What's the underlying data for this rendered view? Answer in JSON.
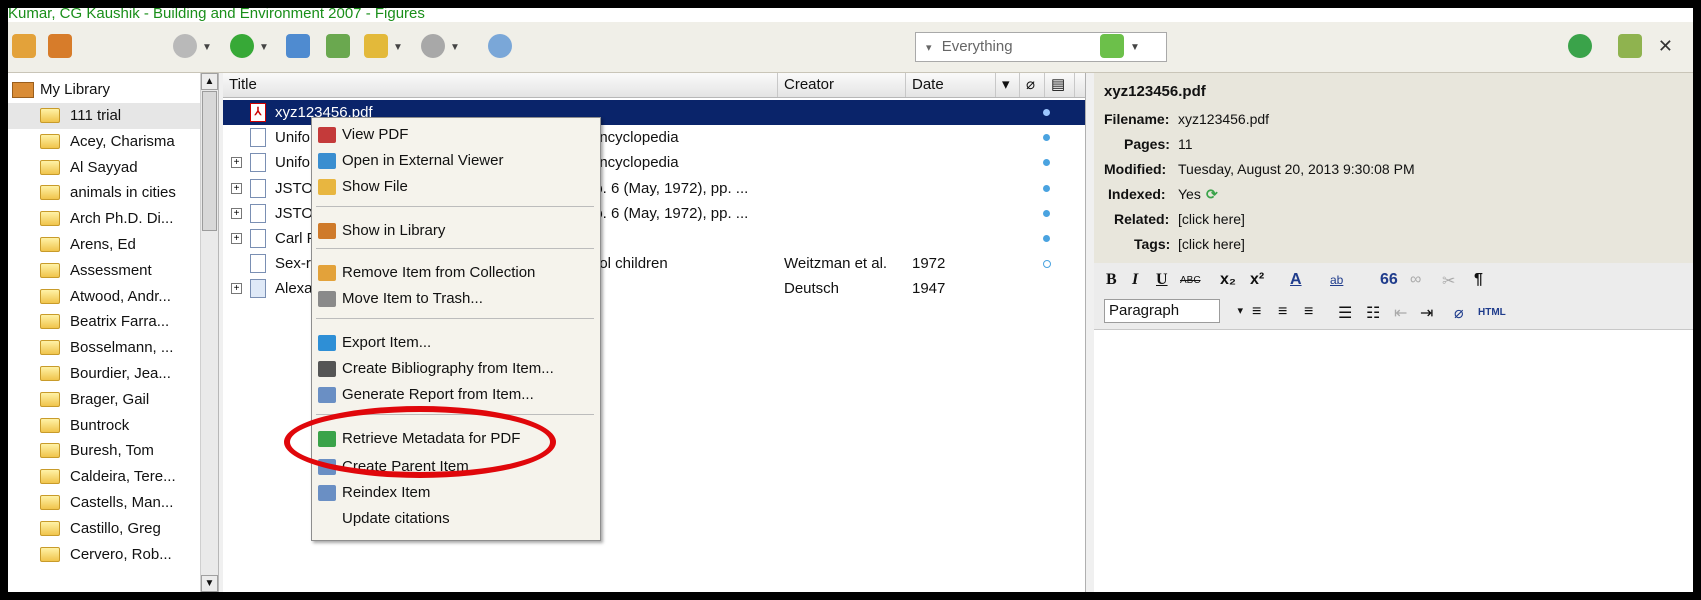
{
  "window": {
    "title": "Kumar, CG Kaushik - Building and Environment 2007 - Figures"
  },
  "toolbar": {
    "search_scope": "Everything",
    "search_dropdown_glyph": "▾"
  },
  "library": {
    "root": "My Library",
    "collections": [
      "111 trial",
      "Acey, Charisma",
      "Al Sayyad",
      "animals in cities",
      "Arch Ph.D. Di...",
      "Arens, Ed",
      "Assessment",
      "Atwood, Andr...",
      "Beatrix Farra...",
      "Bosselmann, ...",
      "Bourdier, Jea...",
      "Brager, Gail",
      "Buntrock",
      "Buresh, Tom",
      "Caldeira, Tere...",
      "Castells, Man...",
      "Castillo, Greg",
      "Cervero, Rob..."
    ]
  },
  "items": {
    "columns": {
      "title": "Title",
      "creator": "Creator",
      "date": "Date"
    },
    "rows": [
      {
        "title": "xyz123456.pdf",
        "creator": "",
        "date": "",
        "expander": "",
        "kind": "pdf",
        "selected": true
      },
      {
        "title": "Unifo",
        "title_tail": "encyclopedia",
        "creator": "",
        "date": "",
        "expander": "",
        "kind": "doc"
      },
      {
        "title": "Unifo",
        "title_tail": "encyclopedia",
        "creator": "",
        "date": "",
        "expander": "+",
        "kind": "doc"
      },
      {
        "title": "JSTO",
        "title_tail": "lo. 6 (May, 1972), pp. ...",
        "creator": "",
        "date": "",
        "expander": "+",
        "kind": "doc"
      },
      {
        "title": "JSTO",
        "title_tail": "lo. 6 (May, 1972), pp. ...",
        "creator": "",
        "date": "",
        "expander": "+",
        "kind": "doc"
      },
      {
        "title": "Carl F",
        "title_tail": "",
        "creator": "",
        "date": "",
        "expander": "+",
        "kind": "doc"
      },
      {
        "title": "Sex-r",
        "title_tail": "ool children",
        "creator": "Weitzman et al.",
        "date": "1972",
        "expander": "",
        "kind": "note"
      },
      {
        "title": "Alexa",
        "title_tail": "",
        "creator": "Deutsch",
        "date": "1947",
        "expander": "+",
        "kind": "book"
      }
    ]
  },
  "context_menu": {
    "items": [
      {
        "label": "View PDF",
        "icon": "pdf-icon"
      },
      {
        "label": "Open in External Viewer",
        "icon": "external-viewer-icon"
      },
      {
        "label": "Show File",
        "icon": "folder-icon"
      },
      {
        "label": "Show in Library",
        "icon": "library-icon"
      },
      {
        "label": "Remove Item from Collection",
        "icon": "remove-icon"
      },
      {
        "label": "Move Item to Trash...",
        "icon": "trash-icon"
      },
      {
        "label": "Export Item...",
        "icon": "export-icon"
      },
      {
        "label": "Create Bibliography from Item...",
        "icon": "bibliography-icon"
      },
      {
        "label": "Generate Report from Item...",
        "icon": "report-icon"
      },
      {
        "label": "Retrieve Metadata for PDF",
        "icon": "puzzle-icon"
      },
      {
        "label": "Create Parent Item",
        "icon": "parent-item-icon"
      },
      {
        "label": "Reindex Item",
        "icon": "reindex-icon"
      },
      {
        "label": "Update citations",
        "icon": ""
      }
    ]
  },
  "attachment_info": {
    "title": "xyz123456.pdf",
    "filename_label": "Filename:",
    "filename": "xyz123456.pdf",
    "pages_label": "Pages:",
    "pages": "11",
    "modified_label": "Modified:",
    "modified": "Tuesday, August 20, 2013 9:30:08 PM",
    "indexed_label": "Indexed:",
    "indexed": "Yes",
    "related_label": "Related:",
    "related": "[click here]",
    "tags_label": "Tags:",
    "tags": "[click here]"
  },
  "editor": {
    "bold": "B",
    "italic": "I",
    "underline": "U",
    "strike": "ABC",
    "subscript": "x₂",
    "superscript": "x²",
    "font_color": "A",
    "highlight": "ab",
    "blockquote": "66",
    "paragraph_mark": "¶",
    "html_button": "HTML",
    "paragraph_format": "Paragraph",
    "select_glyph": "▾"
  },
  "colors": {
    "selection": "#0a246a",
    "highlight_ring": "#e0070b",
    "title_text": "#1a8f1a"
  }
}
